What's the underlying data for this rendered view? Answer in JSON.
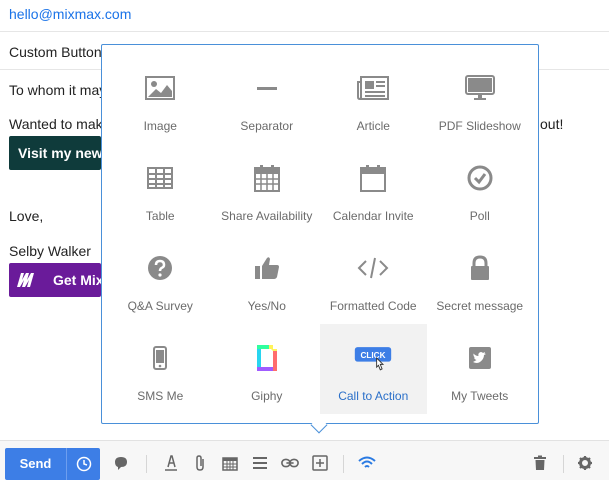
{
  "email": {
    "to": "hello@mixmax.com",
    "subject": "Custom Buttons",
    "body_line1": "To whom it may",
    "body_line2": "Wanted to make",
    "body_line2_end": "out!",
    "visit_button": "Visit my new",
    "signoff": "Love,",
    "signature": "Selby Walker",
    "mix_button": "Get Mix"
  },
  "popup": {
    "items": [
      {
        "label": "Image",
        "icon": "image-icon"
      },
      {
        "label": "Separator",
        "icon": "separator-icon"
      },
      {
        "label": "Article",
        "icon": "article-icon"
      },
      {
        "label": "PDF Slideshow",
        "icon": "monitor-icon"
      },
      {
        "label": "Table",
        "icon": "table-icon"
      },
      {
        "label": "Share Availability",
        "icon": "calendar-grid-icon"
      },
      {
        "label": "Calendar Invite",
        "icon": "calendar-icon"
      },
      {
        "label": "Poll",
        "icon": "check-circle-icon"
      },
      {
        "label": "Q&A Survey",
        "icon": "question-circle-icon"
      },
      {
        "label": "Yes/No",
        "icon": "thumbs-up-icon"
      },
      {
        "label": "Formatted Code",
        "icon": "code-icon"
      },
      {
        "label": "Secret message",
        "icon": "lock-icon"
      },
      {
        "label": "SMS Me",
        "icon": "phone-icon"
      },
      {
        "label": "Giphy",
        "icon": "giphy-icon"
      },
      {
        "label": "Call to Action",
        "icon": "click-badge-icon",
        "badge": "CLICK"
      },
      {
        "label": "My Tweets",
        "icon": "twitter-icon"
      }
    ]
  },
  "toolbar": {
    "send_label": "Send"
  },
  "colors": {
    "accent": "#3d7ee6",
    "popup_border": "#4a90d9",
    "icon_gray": "#8a8a8a",
    "visit_button_bg": "#0f3b3b",
    "mix_button_bg": "#6a1b9a"
  }
}
